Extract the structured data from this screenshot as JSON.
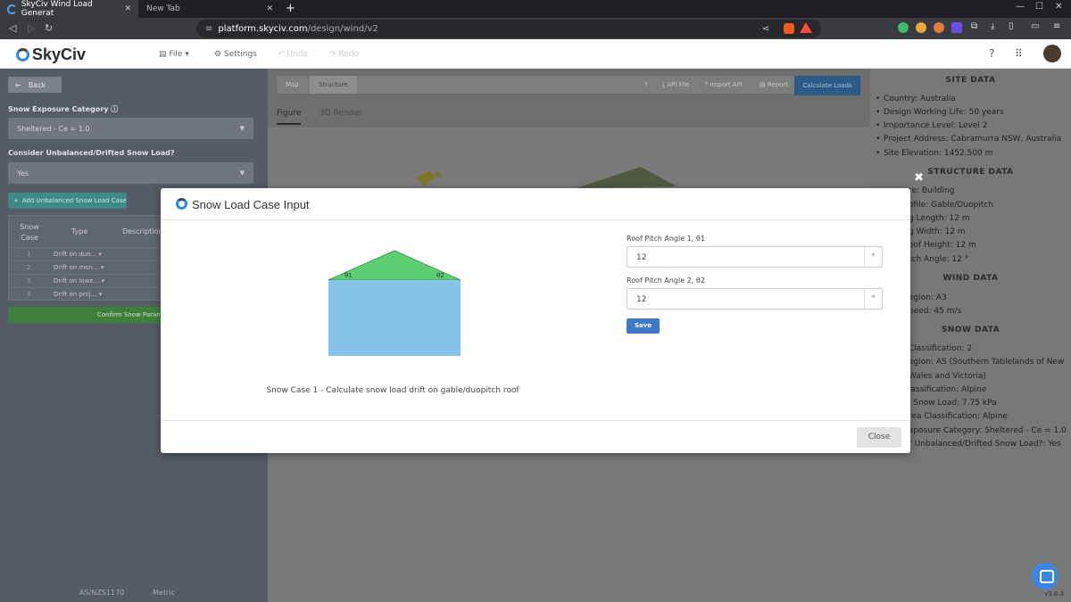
{
  "browser": {
    "active_tab_title": "SkyCiv Wind Load Generat",
    "inactive_tab_title": "New Tab",
    "url_host": "platform.skyciv.com",
    "url_path": "/design/wind/v2"
  },
  "app": {
    "brand": "SkyCiv",
    "menu": {
      "file": "File",
      "settings": "Settings",
      "undo": "Undo",
      "redo": "Redo"
    }
  },
  "left": {
    "back": "Back",
    "snow_exposure_label": "Snow Exposure Category",
    "snow_exposure_value": "Sheltered - Ce = 1.0",
    "unbalanced_label": "Consider Unbalanced/Drifted Snow Load?",
    "unbalanced_value": "Yes",
    "add_case": "Add Unbalanced Snow Load Case",
    "table_headers": {
      "case": "Snow Case",
      "type": "Type",
      "description": "Description"
    },
    "cases": [
      {
        "n": "1",
        "type": "Drift on duo..."
      },
      {
        "n": "2",
        "type": "Drift on mon..."
      },
      {
        "n": "3",
        "type": "Drift on lowe..."
      },
      {
        "n": "4",
        "type": "Drift on proj..."
      }
    ],
    "confirm": "Confirm Snow Parameters",
    "standard": "AS/NZS1170",
    "units": "Metric"
  },
  "center": {
    "tools": {
      "map": "Map",
      "structure": "Structure",
      "help": "?",
      "api_file": "API File",
      "import_api": "Import API",
      "report": "Report",
      "calculate": "Calculate Loads"
    },
    "tabs": {
      "figure": "Figure",
      "render": "3D Render"
    }
  },
  "right": {
    "site_title": "SITE DATA",
    "site": [
      "Country: Australia",
      "Design Working Life: 50 years",
      "Importance Level: Level 2",
      "Project Address: Cabramurra NSW, Australia",
      "Site Elevation: 1452.500 m"
    ],
    "structure_title": "STRUCTURE DATA",
    "structure": [
      "re: Building",
      "ofile: Gable/Duopitch",
      "g Length: 12 m",
      "g Width: 12 m",
      "oof Height: 12 m",
      "tch Angle: 12 °"
    ],
    "wind_title": "WIND DATA",
    "wind": [
      "egion: A3",
      "peed: 45 m/s"
    ],
    "snow_title": "SNOW DATA",
    "snow": [
      "Classification: 2",
      "egion: AS (Southern Tablelands of New",
      "Wales and Victoria)",
      "lassification: Alpine",
      "l Snow Load: 7.75 kPa",
      "rea Classification: Alpine",
      "xposure Category: Sheltered - Ce = 1.0",
      "r Unbalanced/Drifted Snow Load?: Yes"
    ],
    "version": "v3.8.3"
  },
  "modal": {
    "title": "Snow Load Case Input",
    "angle1_label": "Roof Pitch Angle 1, θ1",
    "angle1_value": "12",
    "angle2_label": "Roof Pitch Angle 2, θ2",
    "angle2_value": "12",
    "unit": "°",
    "theta1": "θ1",
    "theta2": "θ2",
    "save": "Save",
    "caption": "Snow Case 1 - Calculate snow load drift on gable/duopitch roof",
    "close": "Close"
  },
  "colors": {
    "roof": "#5dce72",
    "wall": "#86c3e8",
    "accent": "#3f78c6"
  }
}
